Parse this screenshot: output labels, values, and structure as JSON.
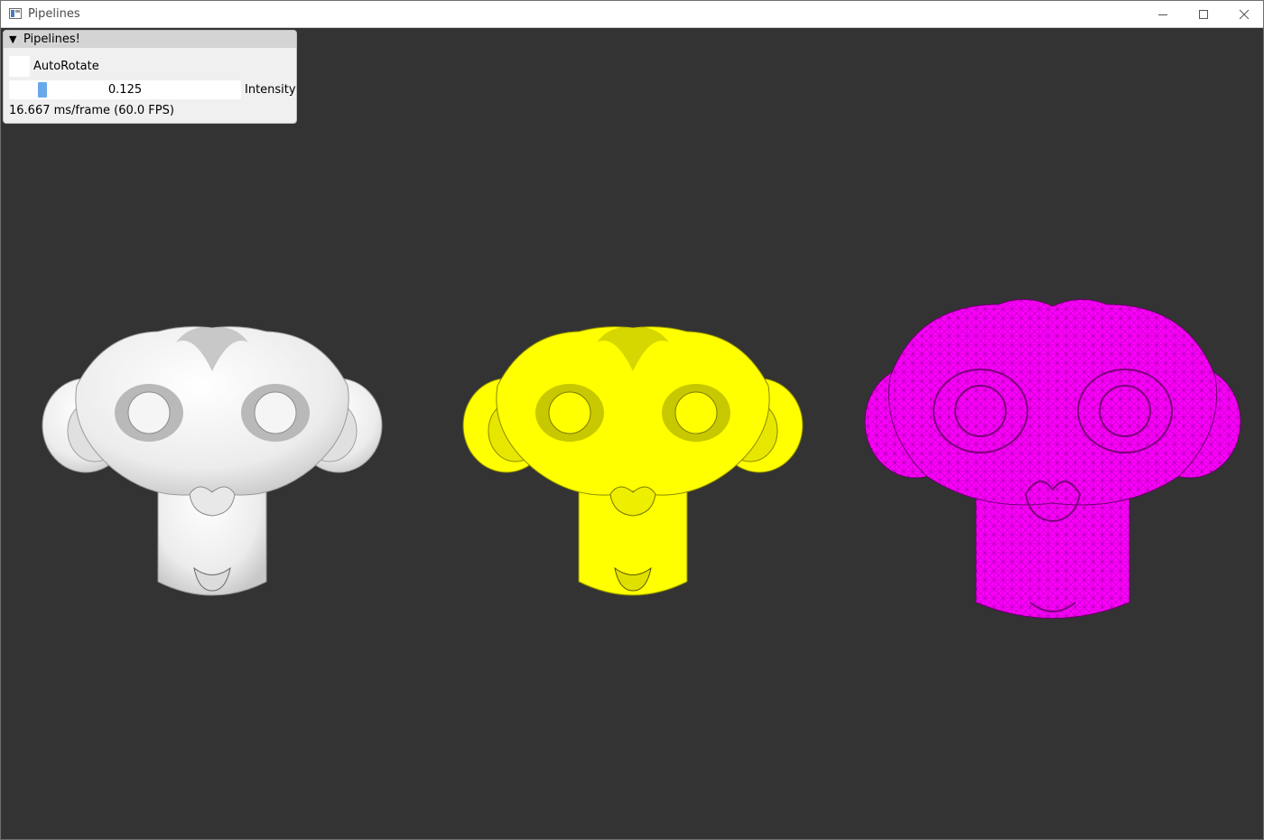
{
  "window": {
    "title": "Pipelines",
    "controls": [
      "minimize-icon",
      "maximize-icon",
      "close-icon"
    ]
  },
  "panel": {
    "header_arrow": "▼",
    "title": "Pipelines!",
    "autorotate": {
      "label": "AutoRotate",
      "checked": false
    },
    "intensity": {
      "label": "Intensity",
      "value": "0.125",
      "fraction": 0.125
    },
    "stats": "16.667 ms/frame (60.0 FPS)"
  },
  "scene": {
    "background_color": "#333333",
    "models": [
      {
        "name": "phong-shaded",
        "color": "#f2f2f2"
      },
      {
        "name": "toon-shaded",
        "color": "#ffff00"
      },
      {
        "name": "wireframe",
        "color": "#ff00ff"
      }
    ]
  }
}
